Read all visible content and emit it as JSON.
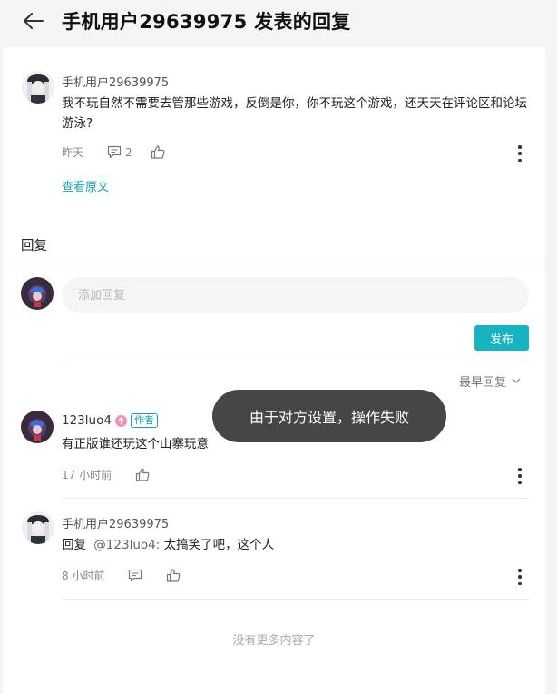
{
  "header": {
    "title": "手机用户29639975 发表的回复"
  },
  "original_post": {
    "username": "手机用户29639975",
    "text": "我不玩自然不需要去管那些游戏，反倒是你，你不玩这个游戏，还天天在评论区和论坛游泳?",
    "time": "昨天",
    "comment_count": "2",
    "view_original": "查看原文"
  },
  "reply_section": {
    "title": "回复",
    "input_placeholder": "添加回复",
    "publish_label": "发布",
    "sort_label": "最早回复"
  },
  "replies": [
    {
      "username": "123luo4",
      "author_badge": "作者",
      "text": "有正版谁还玩这个山寨玩意",
      "time": "17 小时前"
    },
    {
      "username": "手机用户29639975",
      "reply_prefix": "回复",
      "reply_to": "@123luo4:",
      "text": " 太搞笑了吧，这个人",
      "time": "8 小时前"
    }
  ],
  "footer": {
    "no_more": "没有更多内容了"
  },
  "toast": {
    "message": "由于对方设置，操作失败"
  },
  "colors": {
    "accent": "#17b3c1",
    "link": "#17a2b8",
    "toast_bg": "#323232"
  },
  "icons": [
    "back-arrow-icon",
    "comment-icon",
    "thumbs-up-icon",
    "more-vertical-icon",
    "chevron-down-icon"
  ]
}
